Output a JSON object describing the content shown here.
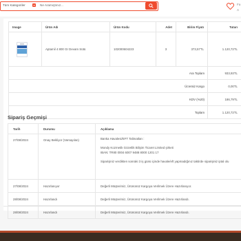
{
  "header": {
    "category_label": "Tüm Kategoriler",
    "search_placeholder": "Ne Aramıştınız...",
    "user_line1": "Fa",
    "user_line2": "A",
    "accent_color": "#ef4c2f"
  },
  "order_table": {
    "columns": [
      "Image",
      "Ürün Adı",
      "Ürün Kodu",
      "Adet",
      "Birim Fiyatı",
      "Tutarı"
    ],
    "rows": [
      {
        "image_icon": "product-image",
        "name": "Aptamil 4 800 Gr Devam Sütü",
        "code": "102000604223",
        "qty": "3",
        "unit_price": "373,57TL",
        "total": "1.120,72TL"
      }
    ],
    "summary": [
      {
        "label": "Ara Toplam",
        "value": "933,93TL"
      },
      {
        "label": "Ücretsiz Kargo",
        "value": "0,00TL"
      },
      {
        "label": "KDV (%20)",
        "value": "186,79TL"
      },
      {
        "label": "Toplam",
        "value": "1.120,72TL"
      }
    ]
  },
  "history": {
    "title": "Sipariş Geçmişi",
    "columns": [
      "Tarih",
      "Durumu",
      "Açıklama"
    ],
    "rows": [
      {
        "date": "27/08/2024",
        "status": "Onay Bekliyor (Varsayılan)",
        "desc_lines": [
          "Banka Havalesi/EFT Talimatları :",
          "Mondy Kozmetik Gözetlik Bilişim Ticaret Limited şirketi",
          "IBAN: TR80 0004 6007 9488 8000 1201 17",
          "Siparişiniz verdikten sonraki 3 iş günü içinde havale/eft yapmadığınız taktirde siparişiniz iptal olu"
        ]
      },
      {
        "date": "27/08/2024",
        "status": "Hazırlanıyor",
        "desc": "Değerli Müşterimiz, Ürününüz Kargoya Verilmek Üzere Hazırlanıyor."
      },
      {
        "date": "28/08/2024",
        "status": "Hazırlandı",
        "desc": "Değerli Müşterimiz, Ürününüz Kargoya Verilmek Üzere Hazırlandı."
      },
      {
        "date": "28/08/2024",
        "status": "Hazırlandı",
        "desc": "Değerli Müşterimiz, Ürününüz Kargoya Verilmek Üzere Hazırlandı."
      }
    ]
  }
}
